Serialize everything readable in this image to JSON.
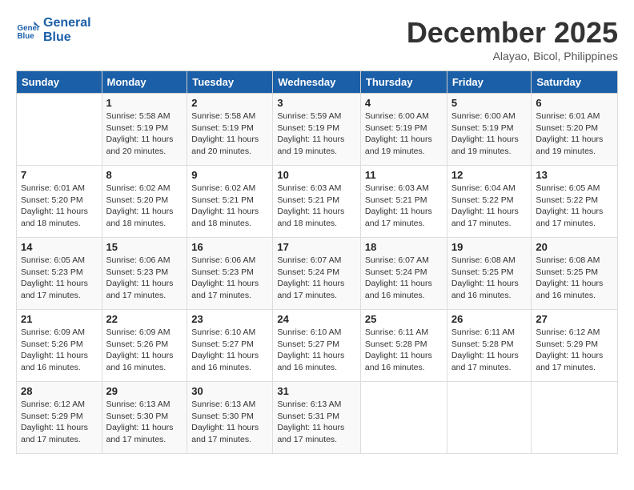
{
  "logo": {
    "line1": "General",
    "line2": "Blue"
  },
  "title": "December 2025",
  "subtitle": "Alayao, Bicol, Philippines",
  "days_of_week": [
    "Sunday",
    "Monday",
    "Tuesday",
    "Wednesday",
    "Thursday",
    "Friday",
    "Saturday"
  ],
  "weeks": [
    [
      {
        "num": "",
        "info": ""
      },
      {
        "num": "1",
        "info": "Sunrise: 5:58 AM\nSunset: 5:19 PM\nDaylight: 11 hours\nand 20 minutes."
      },
      {
        "num": "2",
        "info": "Sunrise: 5:58 AM\nSunset: 5:19 PM\nDaylight: 11 hours\nand 20 minutes."
      },
      {
        "num": "3",
        "info": "Sunrise: 5:59 AM\nSunset: 5:19 PM\nDaylight: 11 hours\nand 19 minutes."
      },
      {
        "num": "4",
        "info": "Sunrise: 6:00 AM\nSunset: 5:19 PM\nDaylight: 11 hours\nand 19 minutes."
      },
      {
        "num": "5",
        "info": "Sunrise: 6:00 AM\nSunset: 5:19 PM\nDaylight: 11 hours\nand 19 minutes."
      },
      {
        "num": "6",
        "info": "Sunrise: 6:01 AM\nSunset: 5:20 PM\nDaylight: 11 hours\nand 19 minutes."
      }
    ],
    [
      {
        "num": "7",
        "info": "Sunrise: 6:01 AM\nSunset: 5:20 PM\nDaylight: 11 hours\nand 18 minutes."
      },
      {
        "num": "8",
        "info": "Sunrise: 6:02 AM\nSunset: 5:20 PM\nDaylight: 11 hours\nand 18 minutes."
      },
      {
        "num": "9",
        "info": "Sunrise: 6:02 AM\nSunset: 5:21 PM\nDaylight: 11 hours\nand 18 minutes."
      },
      {
        "num": "10",
        "info": "Sunrise: 6:03 AM\nSunset: 5:21 PM\nDaylight: 11 hours\nand 18 minutes."
      },
      {
        "num": "11",
        "info": "Sunrise: 6:03 AM\nSunset: 5:21 PM\nDaylight: 11 hours\nand 17 minutes."
      },
      {
        "num": "12",
        "info": "Sunrise: 6:04 AM\nSunset: 5:22 PM\nDaylight: 11 hours\nand 17 minutes."
      },
      {
        "num": "13",
        "info": "Sunrise: 6:05 AM\nSunset: 5:22 PM\nDaylight: 11 hours\nand 17 minutes."
      }
    ],
    [
      {
        "num": "14",
        "info": "Sunrise: 6:05 AM\nSunset: 5:23 PM\nDaylight: 11 hours\nand 17 minutes."
      },
      {
        "num": "15",
        "info": "Sunrise: 6:06 AM\nSunset: 5:23 PM\nDaylight: 11 hours\nand 17 minutes."
      },
      {
        "num": "16",
        "info": "Sunrise: 6:06 AM\nSunset: 5:23 PM\nDaylight: 11 hours\nand 17 minutes."
      },
      {
        "num": "17",
        "info": "Sunrise: 6:07 AM\nSunset: 5:24 PM\nDaylight: 11 hours\nand 17 minutes."
      },
      {
        "num": "18",
        "info": "Sunrise: 6:07 AM\nSunset: 5:24 PM\nDaylight: 11 hours\nand 16 minutes."
      },
      {
        "num": "19",
        "info": "Sunrise: 6:08 AM\nSunset: 5:25 PM\nDaylight: 11 hours\nand 16 minutes."
      },
      {
        "num": "20",
        "info": "Sunrise: 6:08 AM\nSunset: 5:25 PM\nDaylight: 11 hours\nand 16 minutes."
      }
    ],
    [
      {
        "num": "21",
        "info": "Sunrise: 6:09 AM\nSunset: 5:26 PM\nDaylight: 11 hours\nand 16 minutes."
      },
      {
        "num": "22",
        "info": "Sunrise: 6:09 AM\nSunset: 5:26 PM\nDaylight: 11 hours\nand 16 minutes."
      },
      {
        "num": "23",
        "info": "Sunrise: 6:10 AM\nSunset: 5:27 PM\nDaylight: 11 hours\nand 16 minutes."
      },
      {
        "num": "24",
        "info": "Sunrise: 6:10 AM\nSunset: 5:27 PM\nDaylight: 11 hours\nand 16 minutes."
      },
      {
        "num": "25",
        "info": "Sunrise: 6:11 AM\nSunset: 5:28 PM\nDaylight: 11 hours\nand 16 minutes."
      },
      {
        "num": "26",
        "info": "Sunrise: 6:11 AM\nSunset: 5:28 PM\nDaylight: 11 hours\nand 17 minutes."
      },
      {
        "num": "27",
        "info": "Sunrise: 6:12 AM\nSunset: 5:29 PM\nDaylight: 11 hours\nand 17 minutes."
      }
    ],
    [
      {
        "num": "28",
        "info": "Sunrise: 6:12 AM\nSunset: 5:29 PM\nDaylight: 11 hours\nand 17 minutes."
      },
      {
        "num": "29",
        "info": "Sunrise: 6:13 AM\nSunset: 5:30 PM\nDaylight: 11 hours\nand 17 minutes."
      },
      {
        "num": "30",
        "info": "Sunrise: 6:13 AM\nSunset: 5:30 PM\nDaylight: 11 hours\nand 17 minutes."
      },
      {
        "num": "31",
        "info": "Sunrise: 6:13 AM\nSunset: 5:31 PM\nDaylight: 11 hours\nand 17 minutes."
      },
      {
        "num": "",
        "info": ""
      },
      {
        "num": "",
        "info": ""
      },
      {
        "num": "",
        "info": ""
      }
    ]
  ]
}
